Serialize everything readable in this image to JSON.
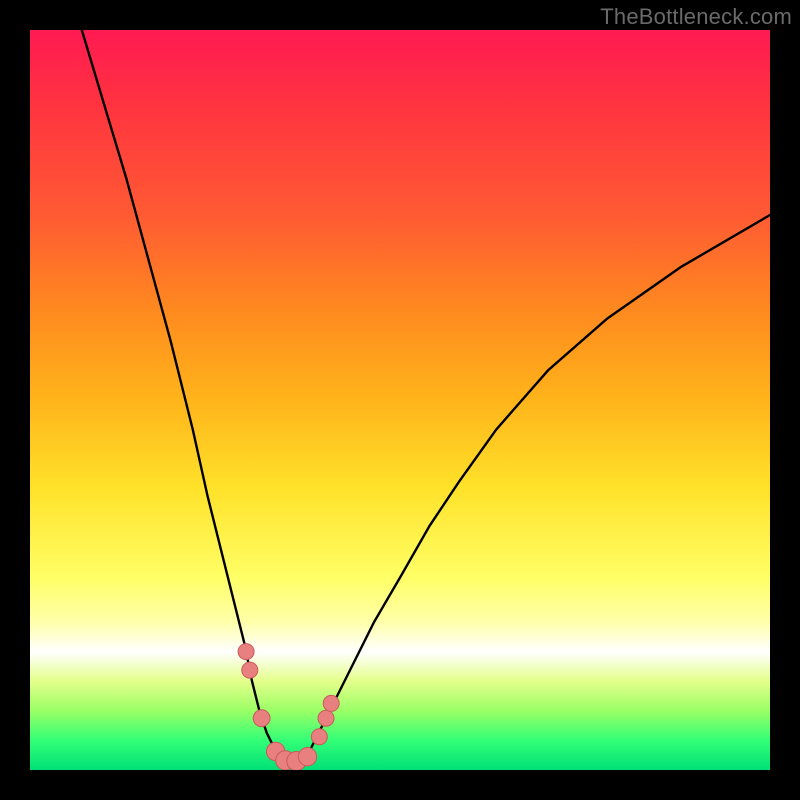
{
  "watermark": "TheBottleneck.com",
  "colors": {
    "frame": "#000000",
    "curve": "#000000",
    "marker_fill": "#e98080",
    "marker_stroke": "#c85a5a",
    "gradient_top": "#ff1a52",
    "gradient_bottom": "#00e077"
  },
  "chart_data": {
    "type": "line",
    "title": "",
    "xlabel": "",
    "ylabel": "",
    "xlim": [
      0,
      100
    ],
    "ylim": [
      0,
      100
    ],
    "series": [
      {
        "name": "bottleneck-curve",
        "x": [
          7,
          10,
          13,
          16,
          19,
          22,
          24,
          26,
          27.5,
          29,
          30,
          31,
          32,
          33,
          34,
          35,
          36,
          37,
          38,
          39,
          40,
          41.5,
          43.5,
          46.5,
          50,
          54,
          58,
          63,
          70,
          78,
          88,
          100
        ],
        "values": [
          100,
          90,
          80,
          69,
          58,
          46,
          37,
          29,
          23,
          17,
          12,
          8,
          5,
          3,
          1.7,
          1.2,
          1.2,
          1.7,
          3,
          5,
          7,
          10,
          14,
          20,
          26,
          33,
          39,
          46,
          54,
          61,
          68,
          75
        ]
      }
    ],
    "markers": {
      "name": "highlight-points",
      "x": [
        29.2,
        29.7,
        31.3,
        33.2,
        34.5,
        36,
        37.5,
        39.1,
        40,
        40.7
      ],
      "values": [
        16,
        13.5,
        7,
        2.5,
        1.3,
        1.2,
        1.8,
        4.5,
        7,
        9
      ],
      "radius_scale": [
        1,
        1,
        1.05,
        1.15,
        1.2,
        1.2,
        1.15,
        1,
        1,
        1
      ]
    }
  }
}
